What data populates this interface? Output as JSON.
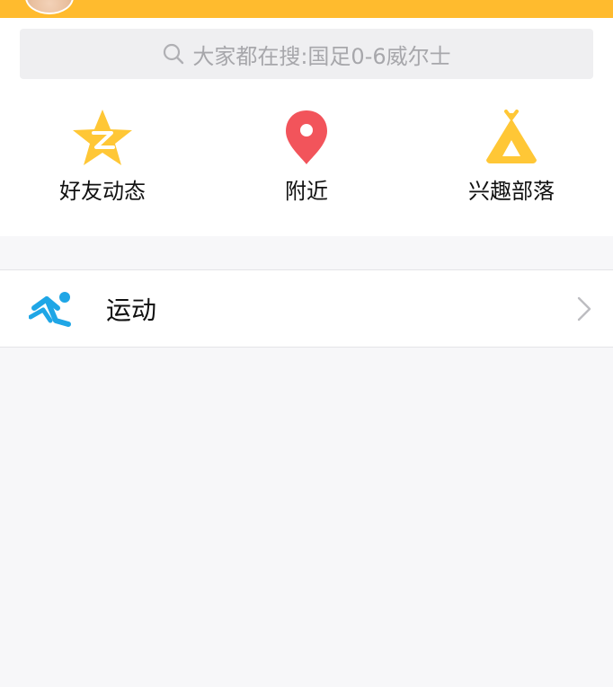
{
  "colors": {
    "header_bg": "#ffbb2e",
    "page_bg": "#f7f7f9",
    "icon_yellow": "#ffc736",
    "icon_red": "#f2545b",
    "icon_blue": "#1fa6e6",
    "text": "#111111",
    "placeholder": "#a7a7ab"
  },
  "search": {
    "icon": "search-icon",
    "placeholder": "大家都在搜:国足0-6威尔士"
  },
  "shortcuts": [
    {
      "icon": "qzone-star-icon",
      "label": "好友动态"
    },
    {
      "icon": "location-pin-icon",
      "label": "附近"
    },
    {
      "icon": "tent-icon",
      "label": "兴趣部落"
    }
  ],
  "list": {
    "items": [
      {
        "icon": "running-icon",
        "label": "运动",
        "trailing_icon": "chevron-right-icon"
      }
    ]
  }
}
